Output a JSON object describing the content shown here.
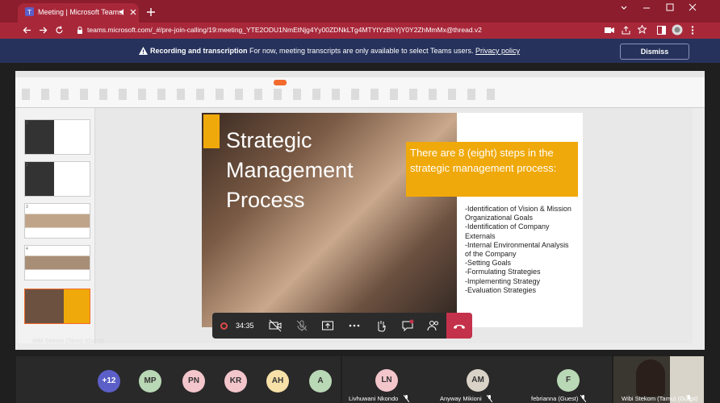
{
  "browser": {
    "tab_title": "Meeting | Microsoft Teams",
    "url": "teams.microsoft.com/_#/pre-join-calling/19:meeting_YTE2ODU1NmEtNjg4Yy00ZDNkLTg4MTYtYzBhYjY0Y2ZhMmMx@thread.v2"
  },
  "banner": {
    "title": "Recording and transcription",
    "message": "For now, meeting transcripts are only available to select Teams users.",
    "link": "Privacy policy",
    "dismiss": "Dismiss"
  },
  "slide": {
    "title_lines": [
      "Strategic",
      "Management",
      "Process"
    ],
    "box_text": "There are 8 (eight) steps in the strategic management process:",
    "steps": [
      "-Identification of Vision & Mission",
      "Organizational Goals",
      "-Identification of Company",
      "Externals",
      "-Internal Environmental Analysis",
      "of the Company",
      "-Setting Goals",
      "-Formulating Strategies",
      "-Implementing Strategy",
      "-Evaluation Strategies"
    ]
  },
  "call": {
    "timer": "34:35",
    "presenter_label": "Wibi Stekom (Tamu) (Guest)"
  },
  "participants": {
    "overflow": "+12",
    "avatars": [
      {
        "initials": "MP",
        "color": "#b9d8b6"
      },
      {
        "initials": "PN",
        "color": "#f3c6cc"
      },
      {
        "initials": "KR",
        "color": "#f3c6cc"
      },
      {
        "initials": "AH",
        "color": "#f7e1a8"
      },
      {
        "initials": "A",
        "color": "#b9d8b6"
      }
    ],
    "named": [
      {
        "initials": "LN",
        "name": "Livhuwani Nkondo",
        "color": "#f3c6cc"
      },
      {
        "initials": "AM",
        "name": "Anyway Mikioni",
        "color": "#d9d2c7"
      },
      {
        "initials": "F",
        "name": "febrianna (Guest)",
        "color": "#b9d8b6"
      }
    ],
    "video_name": "Wibi Stekom (Tamu) (Guest)"
  }
}
